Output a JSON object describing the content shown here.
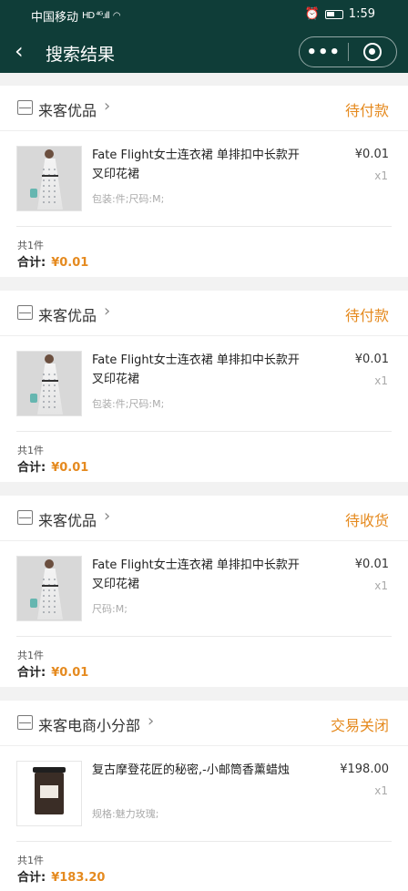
{
  "status_bar": {
    "carrier": "中国移动",
    "time": "1:59"
  },
  "nav": {
    "title": "搜索结果",
    "more_label": "•••"
  },
  "orders": [
    {
      "shop": "来客优品",
      "status": "待付款",
      "item_title": "Fate Flight女士连衣裙 单排扣中长款开叉印花裙",
      "spec": "包装:件;尺码:M;",
      "price": "¥0.01",
      "qty": "x1",
      "count": "共1件",
      "total_label": "合计:",
      "total": "¥0.01",
      "image": "dress-photo"
    },
    {
      "shop": "来客优品",
      "status": "待付款",
      "item_title": "Fate Flight女士连衣裙 单排扣中长款开叉印花裙",
      "spec": "包装:件;尺码:M;",
      "price": "¥0.01",
      "qty": "x1",
      "count": "共1件",
      "total_label": "合计:",
      "total": "¥0.01",
      "image": "dress-photo"
    },
    {
      "shop": "来客优品",
      "status": "待收货",
      "item_title": "Fate Flight女士连衣裙 单排扣中长款开叉印花裙",
      "spec": "尺码:M;",
      "price": "¥0.01",
      "qty": "x1",
      "count": "共1件",
      "total_label": "合计:",
      "total": "¥0.01",
      "image": "dress-photo"
    },
    {
      "shop": "来客电商小分部",
      "status": "交易关闭",
      "item_title": "复古摩登花匠的秘密,-小邮筒香薰蜡烛",
      "spec": "规格:魅力玫瑰;",
      "price": "¥198.00",
      "qty": "x1",
      "count": "共1件",
      "total_label": "合计:",
      "total": "¥183.20",
      "image": "candle-photo"
    }
  ],
  "colors": {
    "header_bg": "#0f3d38",
    "accent": "#e58a1f"
  }
}
